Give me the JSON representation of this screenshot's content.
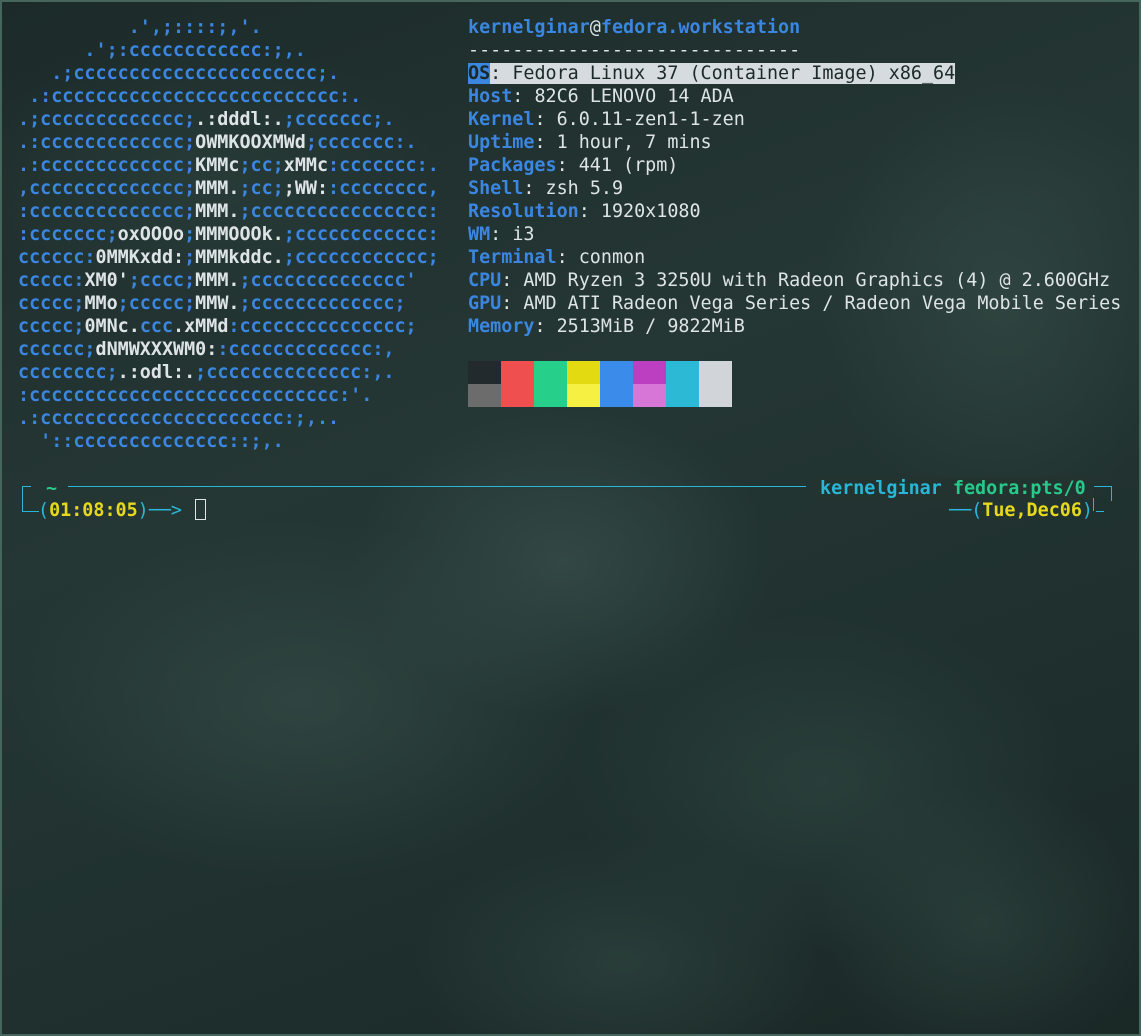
{
  "logo_lines": [
    [
      [
        "b",
        "          .',;::::;,'."
      ]
    ],
    [
      [
        "b",
        "      .';:cccccccccccc:;,."
      ]
    ],
    [
      [
        "b",
        "   .;cccccccccccccccccccccc;."
      ]
    ],
    [
      [
        "b",
        " .:cccccccccccccccccccccccccc:."
      ]
    ],
    [
      [
        "b",
        ".;ccccccccccccc;"
      ],
      [
        "w",
        ".:dddl:."
      ],
      [
        "b",
        ";ccccccc;."
      ]
    ],
    [
      [
        "b",
        ".:ccccccccccccc;"
      ],
      [
        "w",
        "OWMKOOXMWd"
      ],
      [
        "b",
        ";ccccccc:."
      ]
    ],
    [
      [
        "b",
        ".:ccccccccccccc;"
      ],
      [
        "w",
        "KMMc"
      ],
      [
        "b",
        ";cc;"
      ],
      [
        "w",
        "xMMc"
      ],
      [
        "b",
        ":ccccccc:."
      ]
    ],
    [
      [
        "b",
        ",cccccccccccccc;"
      ],
      [
        "w",
        "MMM."
      ],
      [
        "b",
        ";cc;"
      ],
      [
        "w",
        ";WW:"
      ],
      [
        "b",
        ":cccccccc,"
      ]
    ],
    [
      [
        "b",
        ":cccccccccccccc;"
      ],
      [
        "w",
        "MMM."
      ],
      [
        "b",
        ";cccccccccccccccc:"
      ]
    ],
    [
      [
        "b",
        ":ccccccc;"
      ],
      [
        "w",
        "oxOOOo"
      ],
      [
        "b",
        ";"
      ],
      [
        "w",
        "MMMOOOk."
      ],
      [
        "b",
        ";cccccccccccc:"
      ]
    ],
    [
      [
        "b",
        "cccccc:"
      ],
      [
        "w",
        "0MMKxdd:"
      ],
      [
        "b",
        ";"
      ],
      [
        "w",
        "MMMkddc."
      ],
      [
        "b",
        ";cccccccccccc;"
      ]
    ],
    [
      [
        "b",
        "ccccc:"
      ],
      [
        "w",
        "XM0'"
      ],
      [
        "b",
        ";cccc;"
      ],
      [
        "w",
        "MMM."
      ],
      [
        "b",
        ";cccccccccccccc'"
      ]
    ],
    [
      [
        "b",
        "ccccc;"
      ],
      [
        "w",
        "MMo"
      ],
      [
        "b",
        ";ccccc;"
      ],
      [
        "w",
        "MMW."
      ],
      [
        "b",
        ";ccccccccccccc;"
      ]
    ],
    [
      [
        "b",
        "ccccc;"
      ],
      [
        "w",
        "0MNc."
      ],
      [
        "b",
        "ccc"
      ],
      [
        "w",
        ".xMMd"
      ],
      [
        "b",
        ":ccccccccccccccc;"
      ]
    ],
    [
      [
        "b",
        "cccccc;"
      ],
      [
        "w",
        "dNMWXXXWM0:"
      ],
      [
        "b",
        ":ccccccccccccc:,"
      ]
    ],
    [
      [
        "b",
        "cccccccc;"
      ],
      [
        "w",
        ".:odl:."
      ],
      [
        "b",
        ";cccccccccccccc:,."
      ]
    ],
    [
      [
        "b",
        ":cccccccccccccccccccccccccccc:'."
      ]
    ],
    [
      [
        "b",
        ".:cccccccccccccccccccccc:;,.."
      ]
    ],
    [
      [
        "b",
        "  '::cccccccccccccc::;,."
      ]
    ]
  ],
  "header": {
    "user": "kernelginar",
    "at": "@",
    "host": "fedora.workstation",
    "separator": "------------------------------"
  },
  "info": [
    {
      "key": "OS",
      "value": "Fedora Linux 37 (Container Image) x86_64"
    },
    {
      "key": "Host",
      "value": "82C6 LENOVO 14 ADA"
    },
    {
      "key": "Kernel",
      "value": "6.0.11-zen1-1-zen"
    },
    {
      "key": "Uptime",
      "value": "1 hour, 7 mins"
    },
    {
      "key": "Packages",
      "value": "441 (rpm)"
    },
    {
      "key": "Shell",
      "value": "zsh 5.9"
    },
    {
      "key": "Resolution",
      "value": "1920x1080"
    },
    {
      "key": "WM",
      "value": "i3"
    },
    {
      "key": "Terminal",
      "value": "conmon"
    },
    {
      "key": "CPU",
      "value": "AMD Ryzen 3 3250U with Radeon Graphics (4) @ 2.600GHz"
    },
    {
      "key": "GPU",
      "value": "AMD ATI Radeon Vega Series / Radeon Vega Mobile Series"
    },
    {
      "key": "Memory",
      "value": "2513MiB / 9822MiB"
    }
  ],
  "key_separator": ": ",
  "palette": {
    "normal": [
      "#232a2e",
      "#ef4f4f",
      "#26d08a",
      "#e3da12",
      "#3b8cea",
      "#bb3fc0",
      "#2bb9d6",
      "#d1d5d9"
    ],
    "bright": [
      "#6c6c6c",
      "#ef4f4f",
      "#26d08a",
      "#f6f042",
      "#3b8cea",
      "#d776d6",
      "#2bb9d6",
      "#d1d5d9"
    ]
  },
  "prompt": {
    "cwd": "~",
    "user": "kernelginar",
    "host_tty": "fedora:pts/0",
    "time_open": "(",
    "time": "01:08:05",
    "time_close": ")",
    "arrow": "──>",
    "date_open": "(",
    "date": "Tue,Dec06",
    "date_close": ")"
  }
}
